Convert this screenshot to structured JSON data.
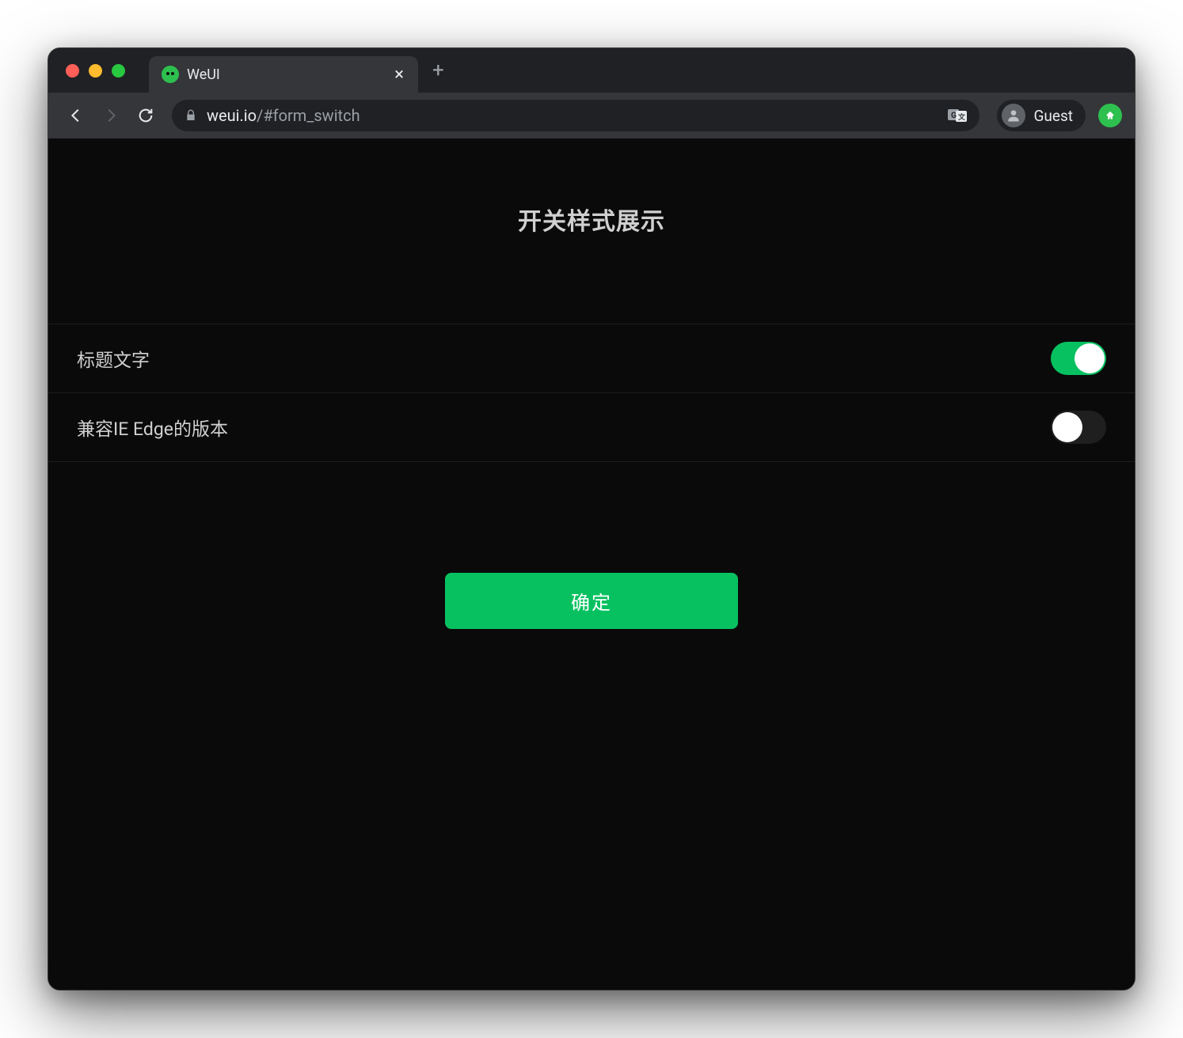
{
  "browser": {
    "tab_title": "WeUI",
    "url_host": "weui.io",
    "url_path": "/#form_switch",
    "profile_label": "Guest",
    "new_tab_glyph": "+",
    "close_glyph": "×"
  },
  "page": {
    "title": "开关样式展示",
    "cells": [
      {
        "label": "标题文字",
        "on": true
      },
      {
        "label": "兼容IE Edge的版本",
        "on": false
      }
    ],
    "confirm_label": "确定"
  },
  "colors": {
    "accent": "#07c160"
  }
}
